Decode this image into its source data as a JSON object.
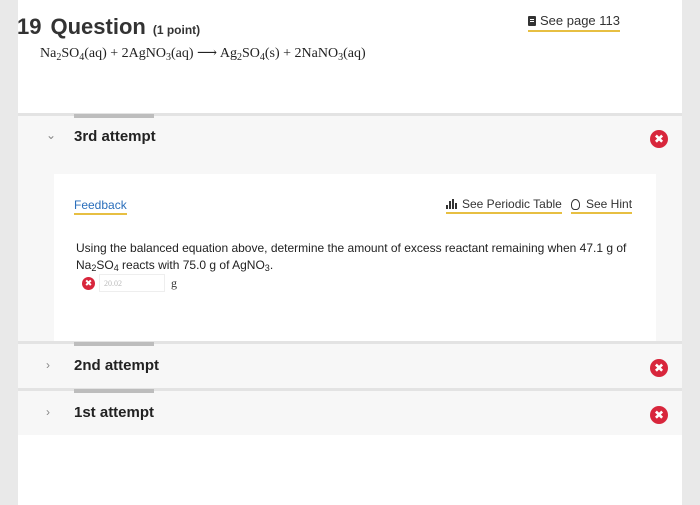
{
  "question": {
    "number": "19",
    "word": "Question",
    "points": "(1 point)",
    "see_page": "See page 113"
  },
  "equation": {
    "t1": "Na",
    "s1": "2",
    "t2": "SO",
    "s2": "4",
    "t3": "(aq) + 2AgNO",
    "s3": "3",
    "t4": "(aq) ⟶ Ag",
    "s4": "2",
    "t5": "SO",
    "s5": "4",
    "t6": "(s) + 2NaNO",
    "s6": "3",
    "t7": "(aq)"
  },
  "attempts": {
    "third": {
      "title": "3rd attempt",
      "feedback": "Feedback",
      "periodic_table": "See Periodic Table",
      "hint": "See Hint",
      "text_a": "Using the balanced equation above, determine the amount of excess reactant remaining when 47.1 g of",
      "text_b1": "Na",
      "text_b1s": "2",
      "text_b2": "SO",
      "text_b2s": "4",
      "text_b3": " reacts with 75.0 g of AgNO",
      "text_b3s": "3",
      "text_b4": ".",
      "answer_value": "20.02",
      "unit": "g"
    },
    "second": {
      "title": "2nd attempt"
    },
    "first": {
      "title": "1st attempt"
    }
  },
  "icons": {
    "chevron_open": "⌄",
    "chevron_closed": "›",
    "x": "✖"
  },
  "colors": {
    "error": "#d8263c",
    "link": "#2a6ebb",
    "underline": "#e7bf42"
  }
}
